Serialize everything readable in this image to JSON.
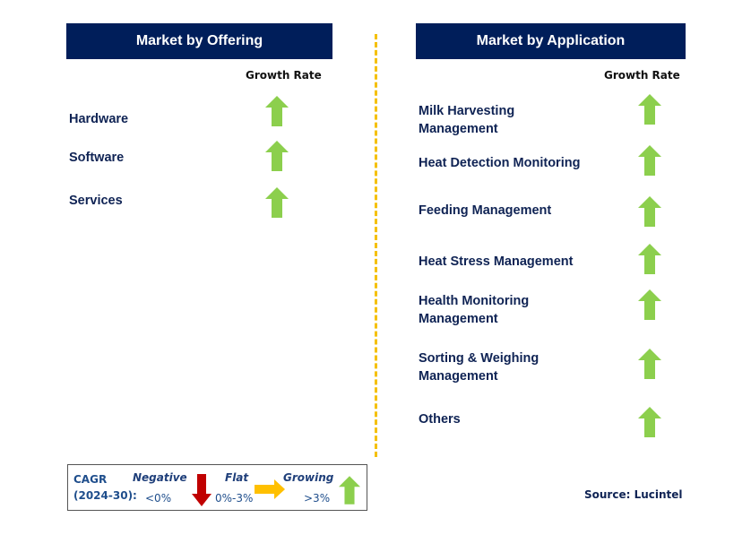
{
  "left_panel": {
    "title": "Market by Offering",
    "growth_header": "Growth Rate",
    "items": [
      {
        "label": "Hardware",
        "trend": "growing"
      },
      {
        "label": "Software",
        "trend": "growing"
      },
      {
        "label": "Services",
        "trend": "growing"
      }
    ]
  },
  "right_panel": {
    "title": "Market by Application",
    "growth_header": "Growth Rate",
    "items": [
      {
        "label_line1": "Milk Harvesting",
        "label_line2": "Management",
        "trend": "growing"
      },
      {
        "label_line1": "Heat Detection Monitoring",
        "label_line2": "",
        "trend": "growing"
      },
      {
        "label_line1": "Feeding Management",
        "label_line2": "",
        "trend": "growing"
      },
      {
        "label_line1": "Heat Stress Management",
        "label_line2": "",
        "trend": "growing"
      },
      {
        "label_line1": "Health Monitoring",
        "label_line2": "Management",
        "trend": "growing"
      },
      {
        "label_line1": "Sorting & Weighing",
        "label_line2": "Management",
        "trend": "growing"
      },
      {
        "label_line1": "Others",
        "label_line2": "",
        "trend": "growing"
      }
    ]
  },
  "legend": {
    "cagr_line1": "CAGR",
    "cagr_line2": "(2024-30):",
    "negative_label": "Negative",
    "negative_range": "<0%",
    "flat_label": "Flat",
    "flat_range": "0%-3%",
    "growing_label": "Growing",
    "growing_range": ">3%"
  },
  "colors": {
    "header_bg": "#001e5a",
    "growing": "#8ccf4d",
    "negative": "#c00000",
    "flat": "#ffc000",
    "divider": "#f5c000"
  },
  "source": "Source: Lucintel"
}
